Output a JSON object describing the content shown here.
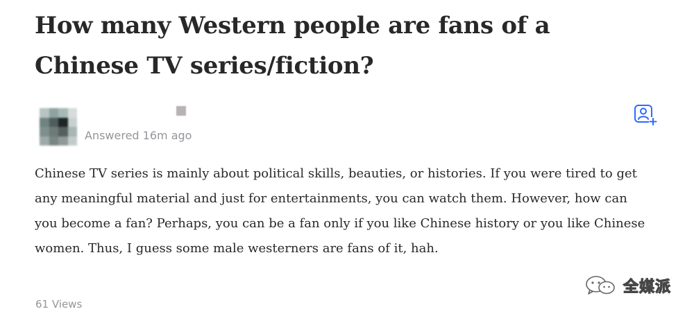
{
  "question": {
    "title": "How many Western people are fans of a Chinese TV series/fiction?"
  },
  "answer": {
    "meta": "Answered 16m ago",
    "body": "Chinese TV series is mainly about political skills, beauties, or histories. If you were tired to get any meaningful material and just for entertainments, you can watch them. However, how can you become a fan? Perhaps, you can be a fan only if you like Chinese history or you like Chinese women. Thus, I guess some male westerners are fans of it, hah.",
    "views": "61 Views",
    "follow_icon": "person-add-icon",
    "accent_color": "#2e69ff"
  },
  "watermark": {
    "text": "全媒派",
    "icon": "wechat-icon"
  }
}
